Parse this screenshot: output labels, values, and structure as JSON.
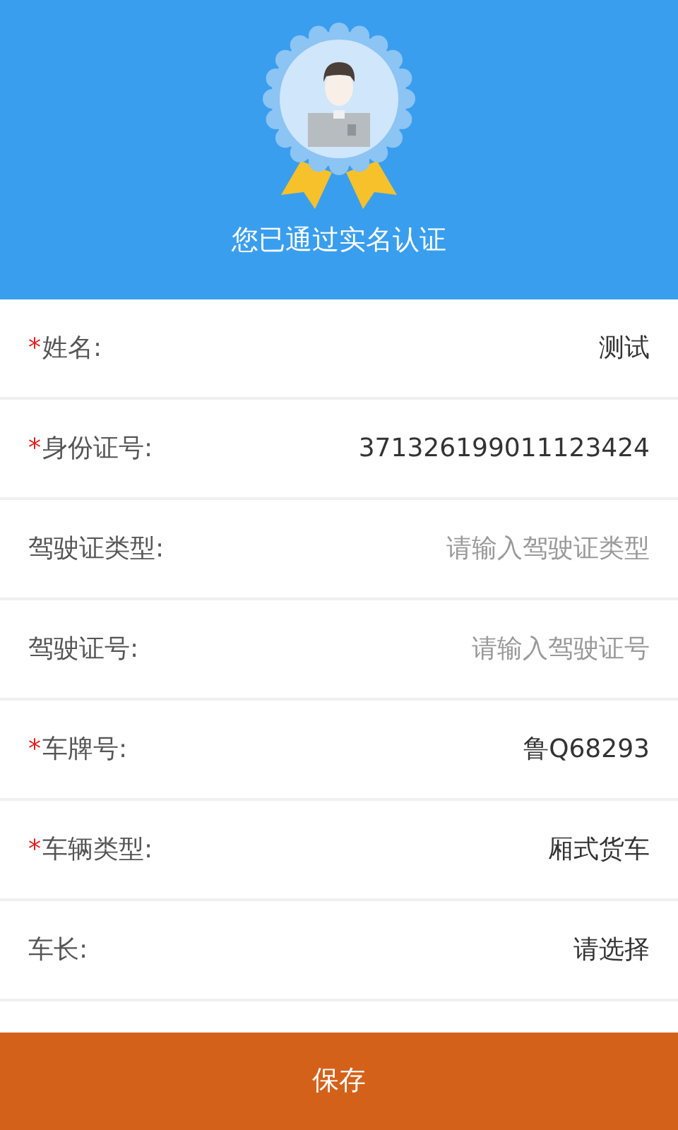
{
  "header": {
    "status": "您已通过实名认证"
  },
  "fields": [
    {
      "required_mark": "*",
      "label": "姓名:",
      "value": "测试"
    },
    {
      "required_mark": "*",
      "label": "身份证号:",
      "value": "371326199011123424"
    },
    {
      "label": "驾驶证类型:",
      "placeholder": "请输入驾驶证类型"
    },
    {
      "label": "驾驶证号:",
      "placeholder": "请输入驾驶证号"
    },
    {
      "required_mark": "*",
      "label": "车牌号:",
      "value": "鲁Q68293"
    },
    {
      "required_mark": "*",
      "label": "车辆类型:",
      "value": "厢式货车"
    },
    {
      "label": "车长:",
      "value": "请选择"
    }
  ],
  "save_button": {
    "label": "保存"
  }
}
